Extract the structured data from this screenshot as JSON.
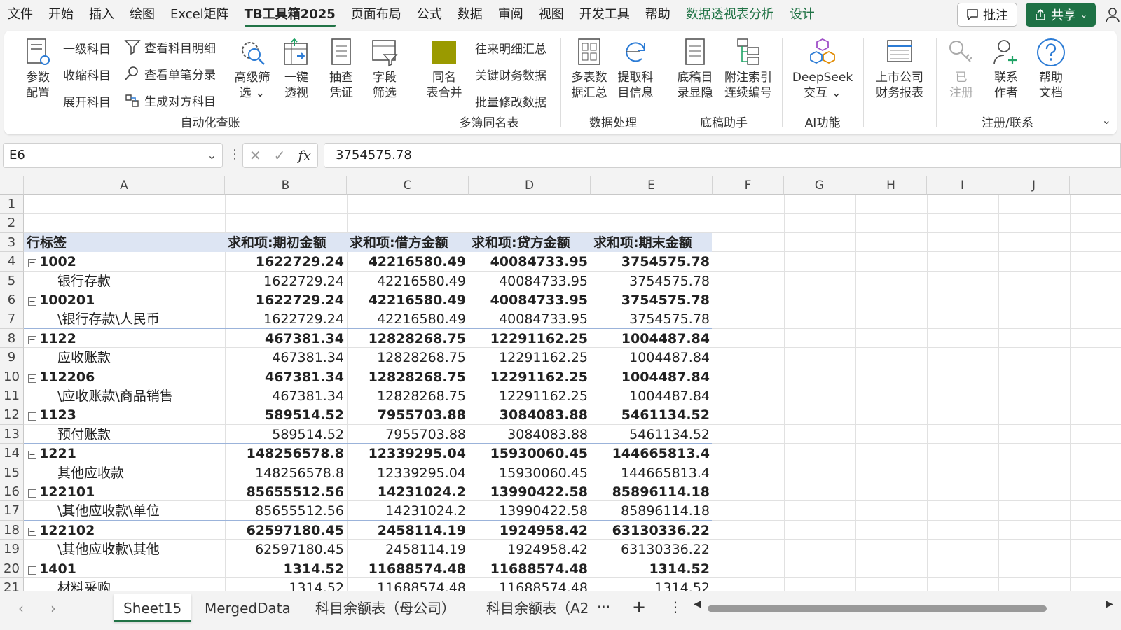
{
  "menu": {
    "items": [
      "文件",
      "开始",
      "插入",
      "绘图",
      "Excel矩阵",
      "TB工具箱2025",
      "页面布局",
      "公式",
      "数据",
      "审阅",
      "视图",
      "开发工具",
      "帮助",
      "数据透视表分析",
      "设计"
    ],
    "active_index": 5,
    "contextual_from": 13,
    "comment_label": "批注",
    "share_label": "共享"
  },
  "ribbon": {
    "groups": {
      "auto_query": "自动化查账",
      "multi_book": "多簿同名表",
      "data_proc": "数据处理",
      "draft_helper": "底稿助手",
      "ai": "AI功能",
      "register": "注册/联系"
    },
    "buttons": {
      "param_config": [
        "参数",
        "配置"
      ],
      "level1": "一级科目",
      "collapse_subj": "收缩科目",
      "expand_subj": "展开科目",
      "view_detail": "查看科目明细",
      "view_entry": "查看单笔分录",
      "gen_opposite": "生成对方科目",
      "adv_filter": [
        "高级筛",
        "选 ⌄"
      ],
      "one_pivot": [
        "一键",
        "透视"
      ],
      "sample_voucher": [
        "抽查",
        "凭证"
      ],
      "field_filter": [
        "字段",
        "筛选"
      ],
      "same_merge": [
        "同名",
        "表合并"
      ],
      "ap_summary": "往来明细汇总",
      "key_fin": "关键财务数据",
      "batch_modify": "批量修改数据",
      "multi_sum": [
        "多表数",
        "据汇总"
      ],
      "fetch_subj": [
        "提取科",
        "目信息"
      ],
      "draft_dir": [
        "底稿目",
        "录显隐"
      ],
      "annot_index": [
        "附注索引",
        "连续编号"
      ],
      "deepseek": [
        "DeepSeek",
        "交互 ⌄"
      ],
      "listed_fin": [
        "上市公司",
        "财务报表"
      ],
      "registered": [
        "已",
        "注册"
      ],
      "contact": [
        "联系",
        "作者"
      ],
      "help_doc": [
        "帮助",
        "文档"
      ]
    }
  },
  "formula_bar": {
    "name_box": "E6",
    "fx": "fx",
    "value": "3754575.78"
  },
  "columns": [
    "A",
    "B",
    "C",
    "D",
    "E",
    "F",
    "G",
    "H",
    "I",
    "J"
  ],
  "rows_numbers": [
    "1",
    "2",
    "3",
    "4",
    "5",
    "6",
    "7",
    "8",
    "9",
    "10",
    "11",
    "12",
    "13",
    "14",
    "15",
    "16",
    "17",
    "18",
    "19",
    "20",
    "21"
  ],
  "pivot": {
    "headers": [
      "行标签",
      "求和项:期初金额",
      "求和项:借方金额",
      "求和项:贷方金额",
      "求和项:期末金额"
    ],
    "rows": [
      {
        "label": "1002",
        "bold": true,
        "collapsible": true,
        "values": [
          "1622729.24",
          "42216580.49",
          "40084733.95",
          "3754575.78"
        ]
      },
      {
        "label": "银行存款",
        "bold": false,
        "collapsible": false,
        "values": [
          "1622729.24",
          "42216580.49",
          "40084733.95",
          "3754575.78"
        ]
      },
      {
        "label": "100201",
        "bold": true,
        "collapsible": true,
        "values": [
          "1622729.24",
          "42216580.49",
          "40084733.95",
          "3754575.78"
        ]
      },
      {
        "label": "\\银行存款\\人民币",
        "bold": false,
        "collapsible": false,
        "values": [
          "1622729.24",
          "42216580.49",
          "40084733.95",
          "3754575.78"
        ]
      },
      {
        "label": "1122",
        "bold": true,
        "collapsible": true,
        "values": [
          "467381.34",
          "12828268.75",
          "12291162.25",
          "1004487.84"
        ]
      },
      {
        "label": "应收账款",
        "bold": false,
        "collapsible": false,
        "values": [
          "467381.34",
          "12828268.75",
          "12291162.25",
          "1004487.84"
        ]
      },
      {
        "label": "112206",
        "bold": true,
        "collapsible": true,
        "values": [
          "467381.34",
          "12828268.75",
          "12291162.25",
          "1004487.84"
        ]
      },
      {
        "label": "\\应收账款\\商品销售",
        "bold": false,
        "collapsible": false,
        "values": [
          "467381.34",
          "12828268.75",
          "12291162.25",
          "1004487.84"
        ]
      },
      {
        "label": "1123",
        "bold": true,
        "collapsible": true,
        "values": [
          "589514.52",
          "7955703.88",
          "3084083.88",
          "5461134.52"
        ]
      },
      {
        "label": "预付账款",
        "bold": false,
        "collapsible": false,
        "values": [
          "589514.52",
          "7955703.88",
          "3084083.88",
          "5461134.52"
        ]
      },
      {
        "label": "1221",
        "bold": true,
        "collapsible": true,
        "values": [
          "148256578.8",
          "12339295.04",
          "15930060.45",
          "144665813.4"
        ]
      },
      {
        "label": "其他应收款",
        "bold": false,
        "collapsible": false,
        "values": [
          "148256578.8",
          "12339295.04",
          "15930060.45",
          "144665813.4"
        ]
      },
      {
        "label": "122101",
        "bold": true,
        "collapsible": true,
        "values": [
          "85655512.56",
          "14231024.2",
          "13990422.58",
          "85896114.18"
        ]
      },
      {
        "label": "\\其他应收款\\单位",
        "bold": false,
        "collapsible": false,
        "values": [
          "85655512.56",
          "14231024.2",
          "13990422.58",
          "85896114.18"
        ]
      },
      {
        "label": "122102",
        "bold": true,
        "collapsible": true,
        "values": [
          "62597180.45",
          "2458114.19",
          "1924958.42",
          "63130336.22"
        ]
      },
      {
        "label": "\\其他应收款\\其他",
        "bold": false,
        "collapsible": false,
        "values": [
          "62597180.45",
          "2458114.19",
          "1924958.42",
          "63130336.22"
        ]
      },
      {
        "label": "1401",
        "bold": true,
        "collapsible": true,
        "values": [
          "1314.52",
          "11688574.48",
          "11688574.48",
          "1314.52"
        ]
      },
      {
        "label": "材料采购",
        "bold": false,
        "collapsible": false,
        "values": [
          "1314.52",
          "11688574.48",
          "11688574.48",
          "1314.52"
        ]
      }
    ]
  },
  "sheet_tabs": {
    "tabs": [
      "Sheet15",
      "MergedData",
      "科目余额表（母公司）",
      "科目余额表（A2"
    ],
    "active_index": 0,
    "more": "···",
    "add": "+",
    "options": "⋮"
  },
  "colors": {
    "accent": "#217346",
    "pivot_header_bg": "#dde5f3"
  }
}
